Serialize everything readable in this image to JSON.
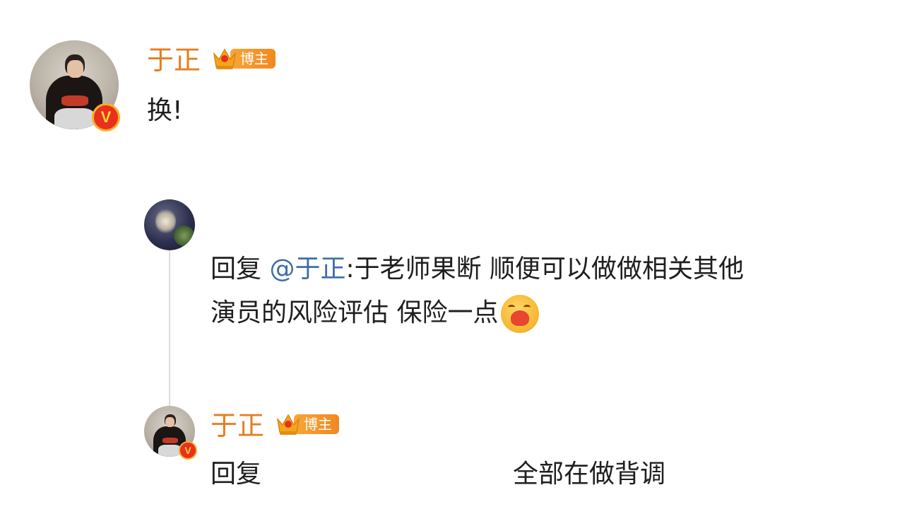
{
  "colors": {
    "username": "#e67d1e",
    "mention": "#3f6ea8",
    "text": "#1f1f1f",
    "verified_badge": "#e8301c",
    "blogger_badge": "#f0891f"
  },
  "comment": {
    "author": "于正",
    "badge_label": "博主",
    "text": "换!"
  },
  "reply1": {
    "reply_prefix": "回复",
    "mention": "@于正",
    "line1": ":于老师果断 顺便可以做做相关其他",
    "line2": "演员的风险评估 保险一点",
    "emoji": "hug-emoji"
  },
  "reply2": {
    "author": "于正",
    "badge_label": "博主",
    "reply_prefix": "回复",
    "text": "全部在做背调"
  }
}
